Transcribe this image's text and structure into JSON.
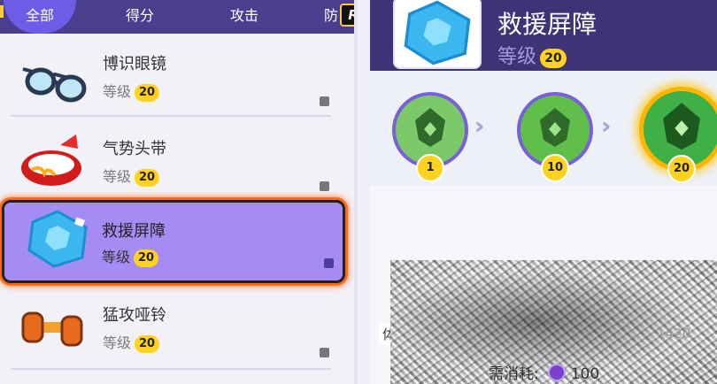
{
  "tabs": {
    "all": "全部",
    "score": "得分",
    "attack": "攻击",
    "defense_partial": "防",
    "badge": "R"
  },
  "items": [
    {
      "name": "博识眼镜",
      "level_label": "等级",
      "level": "20"
    },
    {
      "name": "气势头带",
      "level_label": "等级",
      "level": "20"
    },
    {
      "name": "救援屏障",
      "level_label": "等级",
      "level": "20"
    },
    {
      "name": "猛攻哑铃",
      "level_label": "等级",
      "level": "20"
    }
  ],
  "detail": {
    "title": "救援屏障",
    "level_label": "等级",
    "level": "20",
    "stages": [
      "1",
      "10",
      "20"
    ],
    "stat_label": "体力",
    "stat_value": "1420",
    "cost_label": "需消耗:",
    "cost_value": "100"
  },
  "colors": {
    "header": "#4a3f8f",
    "accent": "#6e5ce6",
    "selected": "#a58cf5",
    "gold": "#ffd21e",
    "highlight": "#ff6a1a"
  }
}
